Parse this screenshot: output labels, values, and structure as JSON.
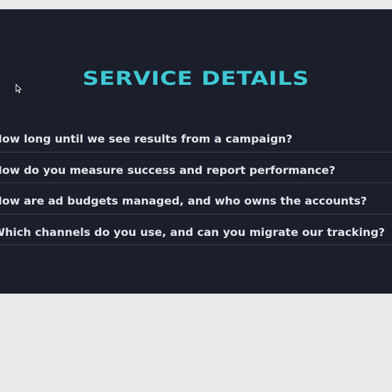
{
  "section": {
    "title": "SERVICE DETAILS"
  },
  "faq": {
    "items": [
      {
        "question": "How long until we see results from a campaign?"
      },
      {
        "question": "How do you measure success and report performance?"
      },
      {
        "question": "How are ad budgets managed, and who owns the accounts?"
      },
      {
        "question": "Which channels do you use, and can you migrate our tracking?"
      }
    ]
  },
  "colors": {
    "panel_background": "#1b1f2b",
    "page_background": "#e9e9e9",
    "title_accent": "#3ec9d4",
    "question_text": "#e4e6ea",
    "divider": "#3a4150"
  },
  "icons": {
    "cursor": "mouse-pointer-icon"
  }
}
